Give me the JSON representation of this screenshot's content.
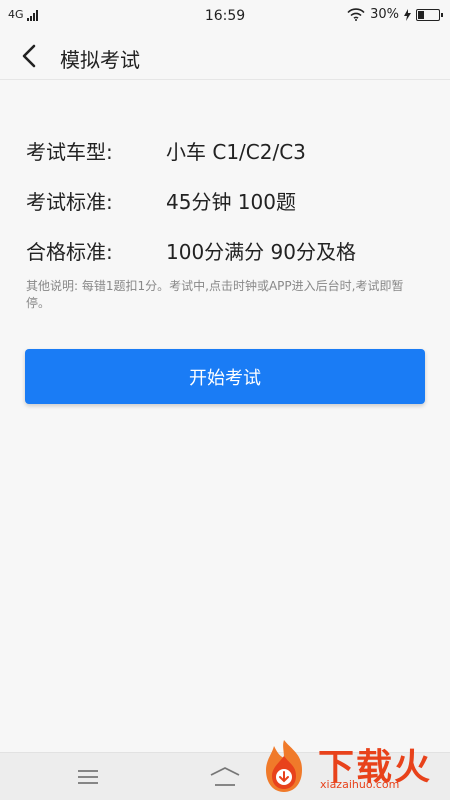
{
  "status_bar": {
    "network": "4G",
    "time": "16:59",
    "battery_percent": "30%",
    "battery_level": 0.3
  },
  "nav": {
    "title": "模拟考试",
    "back_icon": "chevron-left-icon"
  },
  "exam_info": [
    {
      "label": "考试车型:",
      "value": "小车 C1/C2/C3"
    },
    {
      "label": "考试标准:",
      "value": "45分钟 100题"
    },
    {
      "label": "合格标准:",
      "value": "100分满分 90分及格"
    }
  ],
  "note": "其他说明: 每错1题扣1分。考试中,点击时钟或APP进入后台时,考试即暂停。",
  "start_button": {
    "label": "开始考试",
    "color": "#1a7cf5"
  },
  "bottom_nav": {
    "menu_icon": "menu-icon",
    "home_icon": "home-icon"
  },
  "watermark": {
    "text": "下载火",
    "domain": "xiazaihuo.com",
    "color": "#e8421b"
  }
}
